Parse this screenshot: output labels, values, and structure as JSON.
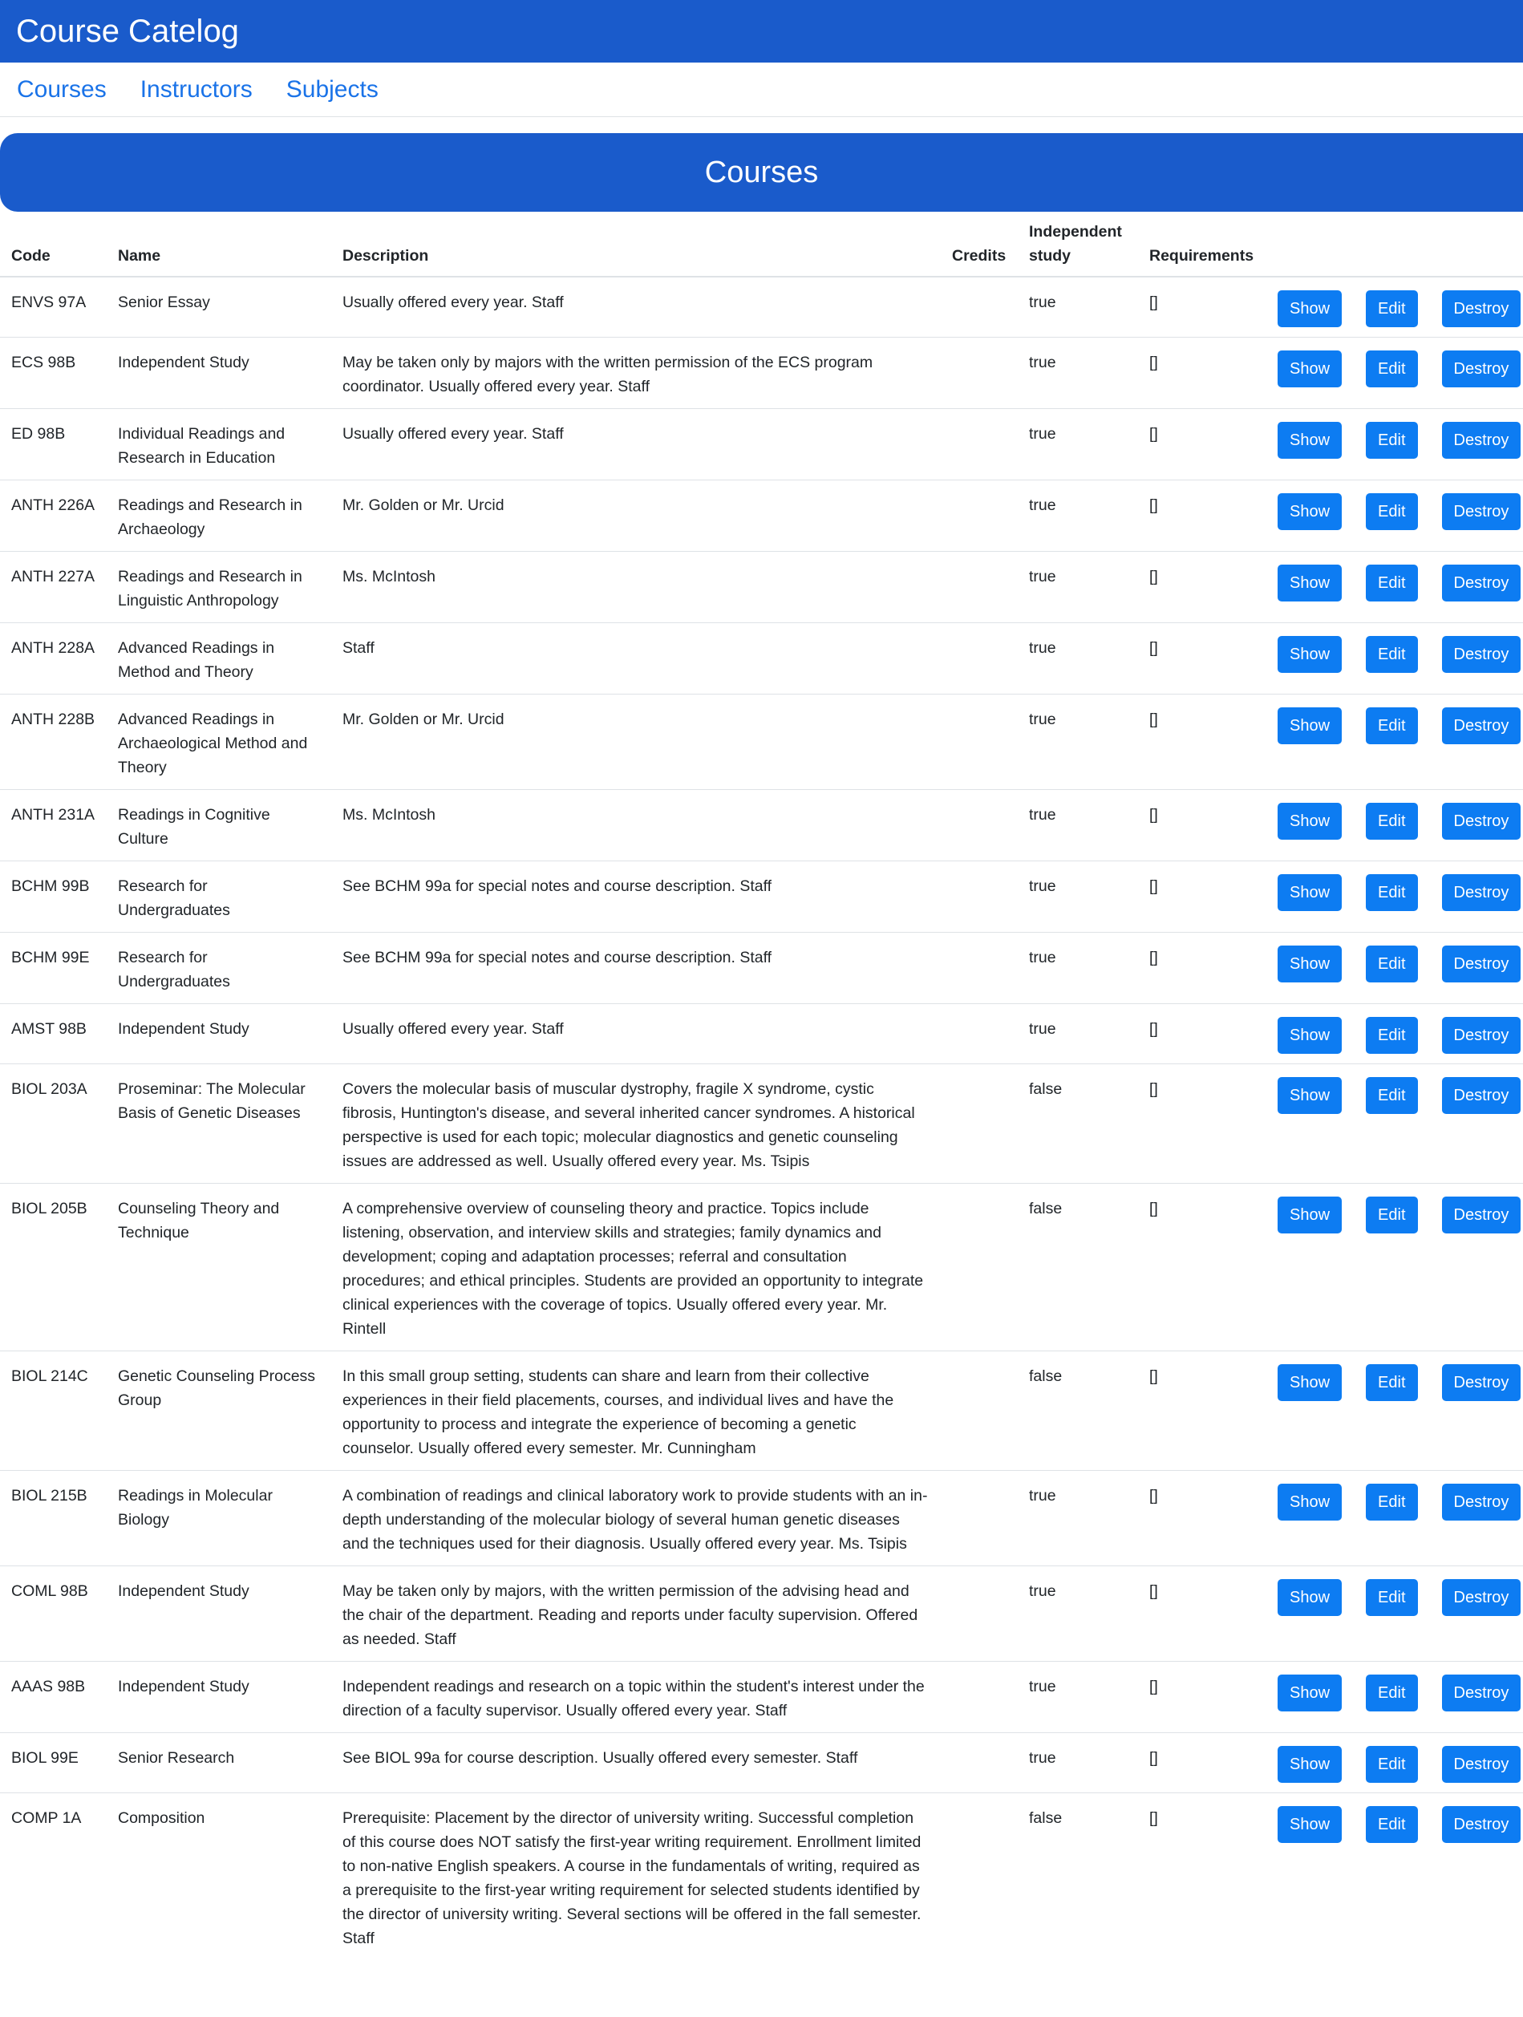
{
  "app": {
    "title": "Course Catelog"
  },
  "nav": [
    {
      "label": "Courses"
    },
    {
      "label": "Instructors"
    },
    {
      "label": "Subjects"
    }
  ],
  "page": {
    "heading": "Courses"
  },
  "table": {
    "headers": {
      "code": "Code",
      "name": "Name",
      "description": "Description",
      "credits": "Credits",
      "independent_line1": "Independent",
      "independent_line2": "study",
      "requirements": "Requirements"
    },
    "actions": {
      "show": "Show",
      "edit": "Edit",
      "destroy": "Destroy"
    },
    "rows": [
      {
        "code": "ENVS 97A",
        "name": "Senior Essay",
        "description": "Usually offered every year. Staff",
        "credits": "",
        "independent": "true",
        "requirements": "[]"
      },
      {
        "code": "ECS 98B",
        "name": "Independent Study",
        "description": "May be taken only by majors with the written permission of the ECS program coordinator. Usually offered every year. Staff",
        "credits": "",
        "independent": "true",
        "requirements": "[]"
      },
      {
        "code": "ED 98B",
        "name": "Individual Readings and Research in Education",
        "description": "Usually offered every year. Staff",
        "credits": "",
        "independent": "true",
        "requirements": "[]"
      },
      {
        "code": "ANTH 226A",
        "name": "Readings and Research in Archaeology",
        "description": "Mr. Golden or Mr. Urcid",
        "credits": "",
        "independent": "true",
        "requirements": "[]"
      },
      {
        "code": "ANTH 227A",
        "name": "Readings and Research in Linguistic Anthropology",
        "description": "Ms. McIntosh",
        "credits": "",
        "independent": "true",
        "requirements": "[]"
      },
      {
        "code": "ANTH 228A",
        "name": "Advanced Readings in Method and Theory",
        "description": "Staff",
        "credits": "",
        "independent": "true",
        "requirements": "[]"
      },
      {
        "code": "ANTH 228B",
        "name": "Advanced Readings in Archaeological Method and Theory",
        "description": "Mr. Golden or Mr. Urcid",
        "credits": "",
        "independent": "true",
        "requirements": "[]"
      },
      {
        "code": "ANTH 231A",
        "name": "Readings in Cognitive Culture",
        "description": "Ms. McIntosh",
        "credits": "",
        "independent": "true",
        "requirements": "[]"
      },
      {
        "code": "BCHM 99B",
        "name": "Research for Undergraduates",
        "description": "See BCHM 99a for special notes and course description. Staff",
        "credits": "",
        "independent": "true",
        "requirements": "[]"
      },
      {
        "code": "BCHM 99E",
        "name": "Research for Undergraduates",
        "description": "See BCHM 99a for special notes and course description. Staff",
        "credits": "",
        "independent": "true",
        "requirements": "[]"
      },
      {
        "code": "AMST 98B",
        "name": "Independent Study",
        "description": "Usually offered every year. Staff",
        "credits": "",
        "independent": "true",
        "requirements": "[]"
      },
      {
        "code": "BIOL 203A",
        "name": "Proseminar: The Molecular Basis of Genetic Diseases",
        "description": "Covers the molecular basis of muscular dystrophy, fragile X syndrome, cystic fibrosis, Huntington's disease, and several inherited cancer syndromes. A historical perspective is used for each topic; molecular diagnostics and genetic counseling issues are addressed as well. Usually offered every year. Ms. Tsipis",
        "credits": "",
        "independent": "false",
        "requirements": "[]"
      },
      {
        "code": "BIOL 205B",
        "name": "Counseling Theory and Technique",
        "description": "A comprehensive overview of counseling theory and practice. Topics include listening, observation, and interview skills and strategies; family dynamics and development; coping and adaptation processes; referral and consultation procedures; and ethical principles. Students are provided an opportunity to integrate clinical experiences with the coverage of topics. Usually offered every year. Mr. Rintell",
        "credits": "",
        "independent": "false",
        "requirements": "[]"
      },
      {
        "code": "BIOL 214C",
        "name": "Genetic Counseling Process Group",
        "description": "In this small group setting, students can share and learn from their collective experiences in their field placements, courses, and individual lives and have the opportunity to process and integrate the experience of becoming a genetic counselor. Usually offered every semester. Mr. Cunningham",
        "credits": "",
        "independent": "false",
        "requirements": "[]"
      },
      {
        "code": "BIOL 215B",
        "name": "Readings in Molecular Biology",
        "description": "A combination of readings and clinical laboratory work to provide students with an in-depth understanding of the molecular biology of several human genetic diseases and the techniques used for their diagnosis. Usually offered every year. Ms. Tsipis",
        "credits": "",
        "independent": "true",
        "requirements": "[]"
      },
      {
        "code": "COML 98B",
        "name": "Independent Study",
        "description": "May be taken only by majors, with the written permission of the advising head and the chair of the department. Reading and reports under faculty supervision. Offered as needed. Staff",
        "credits": "",
        "independent": "true",
        "requirements": "[]"
      },
      {
        "code": "AAAS 98B",
        "name": "Independent Study",
        "description": "Independent readings and research on a topic within the student's interest under the direction of a faculty supervisor. Usually offered every year. Staff",
        "credits": "",
        "independent": "true",
        "requirements": "[]"
      },
      {
        "code": "BIOL 99E",
        "name": "Senior Research",
        "description": "See BIOL 99a for course description. Usually offered every semester. Staff",
        "credits": "",
        "independent": "true",
        "requirements": "[]"
      },
      {
        "code": "COMP 1A",
        "name": "Composition",
        "description": "Prerequisite: Placement by the director of university writing. Successful completion of this course does NOT satisfy the first-year writing requirement. Enrollment limited to non-native English speakers. A course in the fundamentals of writing, required as a prerequisite to the first-year writing requirement for selected students identified by the director of university writing. Several sections will be offered in the fall semester. Staff",
        "credits": "",
        "independent": "false",
        "requirements": "[]"
      }
    ]
  }
}
